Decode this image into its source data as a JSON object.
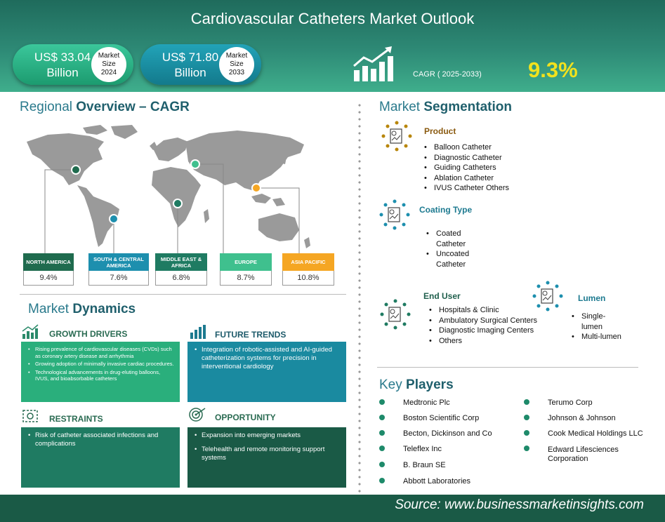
{
  "header": {
    "title": "Cardiovascular Catheters Market Outlook",
    "market_2024": {
      "value": "US$ 33.04",
      "unit": "Billion",
      "label_1": "Market",
      "label_2": "Size",
      "year": "2024"
    },
    "market_2033": {
      "value": "US$ 71.80",
      "unit": "Billion",
      "label_1": "Market",
      "label_2": "Size",
      "year": "2033"
    },
    "cagr_label": "CAGR ( 2025-2033)",
    "cagr_value": "9.3%"
  },
  "regional": {
    "title_light": "Regional",
    "title_bold": "Overview – CAGR",
    "regions": [
      {
        "name": "NORTH AMERICA",
        "value": "9.4%",
        "color": "#1f6b4e"
      },
      {
        "name": "SOUTH & CENTRAL AMERICA",
        "value": "7.6%",
        "color": "#1d8fae"
      },
      {
        "name": "MIDDLE EAST & AFRICA",
        "value": "6.8%",
        "color": "#1f7b62"
      },
      {
        "name": "EUROPE",
        "value": "8.7%",
        "color": "#3fc08e"
      },
      {
        "name": "ASIA PACIFIC",
        "value": "10.8%",
        "color": "#f5a623"
      }
    ]
  },
  "dynamics": {
    "title_light": "Market",
    "title_bold": "Dynamics",
    "growth_drivers": {
      "title": "GROWTH DRIVERS",
      "items": [
        "Rising prevalence of cardiovascular diseases (CVDs) such as coronary artery disease and arrhythmia",
        "Growing adoption of minimally invasive cardiac procedures.",
        "Technological advancements in drug-eluting balloons, IVUS, and bioabsorbable catheters"
      ]
    },
    "future_trends": {
      "title": "FUTURE TRENDS",
      "items": [
        "Integration of robotic-assisted and AI-guided catheterization systems for precision in interventional cardiology"
      ]
    },
    "restraints": {
      "title": "RESTRAINTS",
      "items": [
        "Risk of catheter associated infections and complications"
      ]
    },
    "opportunity": {
      "title": "OPPORTUNITY",
      "items": [
        "Expansion into emerging markets",
        "Telehealth and remote monitoring support systems"
      ]
    }
  },
  "segmentation": {
    "title_light": "Market",
    "title_bold": "Segmentation",
    "product": {
      "title": "Product",
      "color": "#b8860b",
      "items": [
        "Balloon Catheter",
        "Diagnostic Catheter",
        "Guiding Catheters",
        "Ablation Catheter",
        "IVUS Catheter Others"
      ]
    },
    "coating": {
      "title": "Coating Type",
      "color": "#1d8fae",
      "items": [
        "Coated Catheter",
        "Uncoated Catheter"
      ]
    },
    "end_user": {
      "title": "End User",
      "color": "#1f7b62",
      "items": [
        "Hospitals & Clinic",
        "Ambulatory Surgical Centers",
        "Diagnostic Imaging Centers",
        "Others"
      ]
    },
    "lumen": {
      "title": "Lumen",
      "color": "#1d8fae",
      "items": [
        "Single-lumen",
        "Multi-lumen"
      ]
    }
  },
  "players": {
    "title_light": "Key",
    "title_bold": "Players",
    "left": [
      "Medtronic Plc",
      "Boston Scientific Corp",
      "Becton, Dickinson and Co",
      "Teleflex Inc",
      "B. Braun SE",
      "Abbott Laboratories"
    ],
    "right": [
      "Terumo Corp",
      "Johnson & Johnson",
      "Cook Medical Holdings LLC",
      "Edward Lifesciences Corporation"
    ]
  },
  "footer": {
    "source": "Source:  www.businessmarketinsights.com"
  }
}
